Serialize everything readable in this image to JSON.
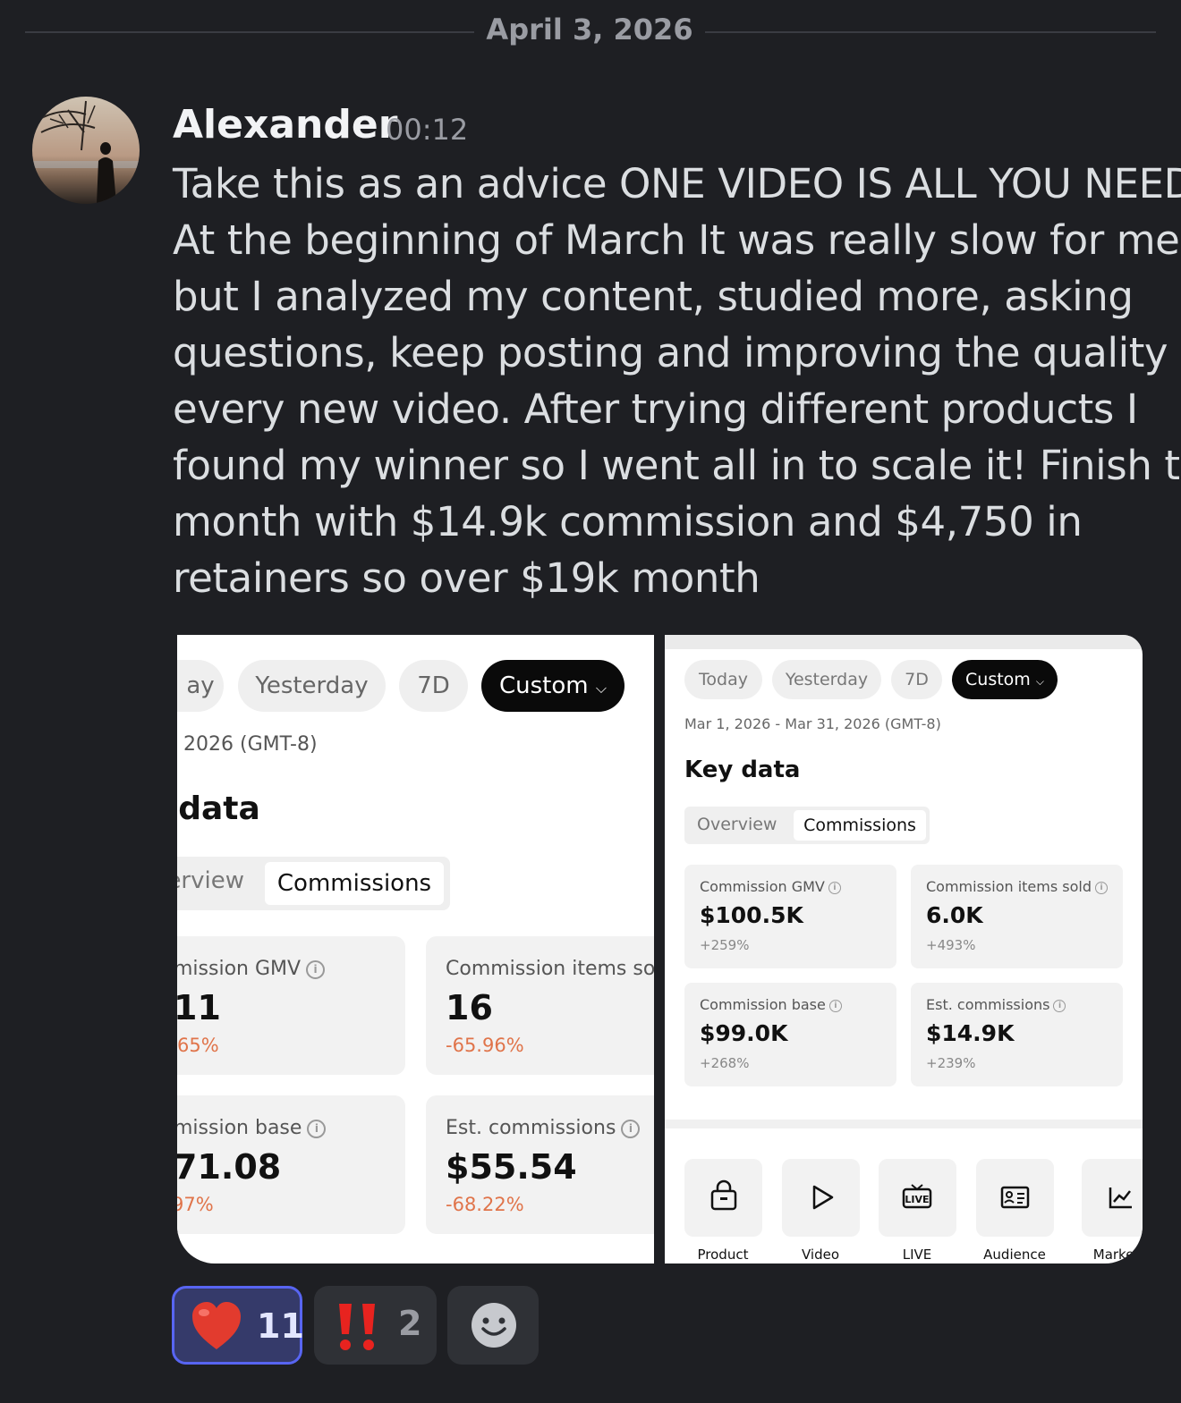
{
  "date_divider": "April 3, 2026",
  "message": {
    "author": "Alexander",
    "time": "00:12",
    "lines": [
      "Take this as an advice ONE VIDEO IS ALL YOU NEED.",
      "At the beginning of March It was really slow for me",
      "but I analyzed my content, studied more, asking",
      "questions, keep posting and improving the quality on",
      "every new video. After trying different products I",
      "found my winner so I went all in to scale it! Finish the",
      "month with $14.9k commission and $4,750 in",
      "retainers so over $19k month"
    ]
  },
  "shot1": {
    "pills": [
      "ay",
      "Yesterday",
      "7D",
      "Custom"
    ],
    "date_range": "2026 (GMT-8)",
    "section_title": "data",
    "tabs": [
      "erview",
      "Commissions"
    ],
    "cards": [
      {
        "label": "mission GMV",
        "value": "11",
        "pct": "65%"
      },
      {
        "label": "Commission items sol",
        "value": "16",
        "pct": "-65.96%"
      },
      {
        "label": "mission base",
        "value": "71.08",
        "pct": "97%"
      },
      {
        "label": "Est. commissions",
        "value": "$55.54",
        "pct": "-68.22%"
      }
    ]
  },
  "shot2": {
    "pills": [
      "Today",
      "Yesterday",
      "7D",
      "Custom"
    ],
    "date_range": "Mar 1, 2026 - Mar 31, 2026 (GMT-8)",
    "section_title": "Key data",
    "tabs": [
      "Overview",
      "Commissions"
    ],
    "cards": [
      {
        "label": "Commission GMV",
        "value": "$100.5K",
        "pct": "+259%"
      },
      {
        "label": "Commission items sold",
        "value": "6.0K",
        "pct": "+493%"
      },
      {
        "label": "Commission base",
        "value": "$99.0K",
        "pct": "+268%"
      },
      {
        "label": "Est. commissions",
        "value": "$14.9K",
        "pct": "+239%"
      }
    ],
    "tiles": [
      "Product",
      "Video",
      "LIVE",
      "Audience",
      "Market i"
    ]
  },
  "reactions": [
    {
      "emoji": "heart",
      "count": "11",
      "active": true
    },
    {
      "emoji": "double-exclamation",
      "count": "2",
      "active": false
    },
    {
      "emoji": "add-reaction",
      "count": "",
      "active": false
    }
  ],
  "colors": {
    "background": "#1e1f23",
    "negative_pct": "#e0744a",
    "reaction_active_border": "#5865f2"
  }
}
